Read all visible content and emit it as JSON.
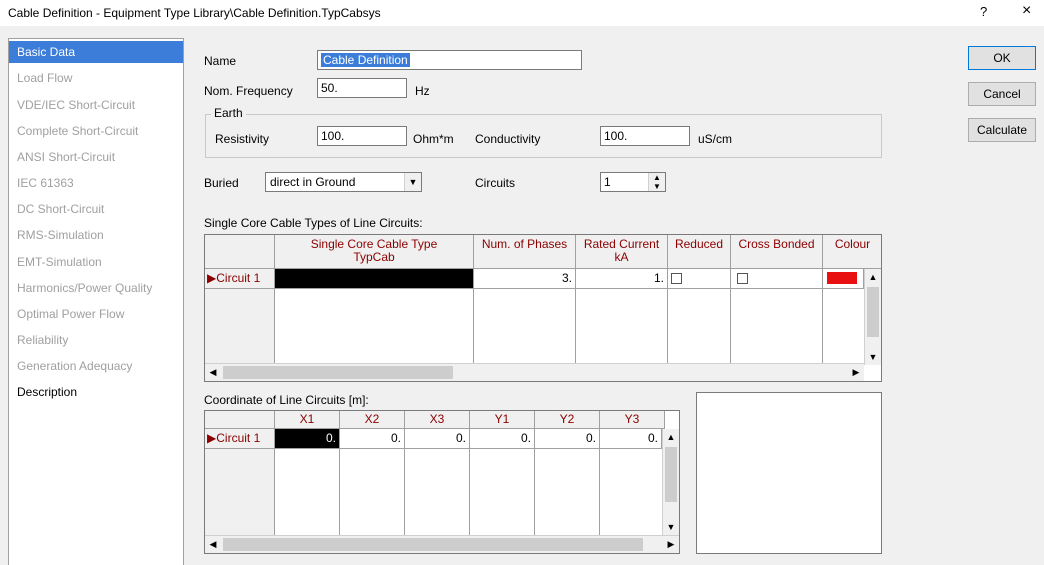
{
  "window": {
    "title": "Cable Definition - Equipment Type Library\\Cable Definition.TypCabsys",
    "help_label": "?",
    "close_label": "×"
  },
  "sidebar": {
    "items": [
      {
        "label": "Basic Data",
        "state": "selected"
      },
      {
        "label": "Load Flow",
        "state": "disabled"
      },
      {
        "label": "VDE/IEC Short-Circuit",
        "state": "disabled"
      },
      {
        "label": "Complete Short-Circuit",
        "state": "disabled"
      },
      {
        "label": "ANSI Short-Circuit",
        "state": "disabled"
      },
      {
        "label": "IEC 61363",
        "state": "disabled"
      },
      {
        "label": "DC Short-Circuit",
        "state": "disabled"
      },
      {
        "label": "RMS-Simulation",
        "state": "disabled"
      },
      {
        "label": "EMT-Simulation",
        "state": "disabled"
      },
      {
        "label": "Harmonics/Power Quality",
        "state": "disabled"
      },
      {
        "label": "Optimal Power Flow",
        "state": "disabled"
      },
      {
        "label": "Reliability",
        "state": "disabled"
      },
      {
        "label": "Generation Adequacy",
        "state": "disabled"
      },
      {
        "label": "Description",
        "state": "enabled"
      }
    ]
  },
  "buttons": {
    "ok": "OK",
    "cancel": "Cancel",
    "calculate": "Calculate"
  },
  "form": {
    "name_label": "Name",
    "name_value": "Cable Definition",
    "freq_label": "Nom. Frequency",
    "freq_value": "50.",
    "freq_unit": "Hz",
    "earth_label": "Earth",
    "resistivity_label": "Resistivity",
    "resistivity_value": "100.",
    "resistivity_unit": "Ohm*m",
    "conductivity_label": "Conductivity",
    "conductivity_value": "100.",
    "conductivity_unit": "uS/cm",
    "buried_label": "Buried",
    "buried_value": "direct in Ground",
    "circuits_label": "Circuits",
    "circuits_value": "1"
  },
  "single_core_table": {
    "title": "Single Core Cable Types of Line Circuits:",
    "headers": {
      "type": "Single Core Cable Type",
      "type_sub": "TypCab",
      "phases": "Num. of Phases",
      "rated": "Rated Current",
      "rated_sub": "kA",
      "reduced": "Reduced",
      "cross": "Cross Bonded",
      "colour": "Colour"
    },
    "row": {
      "label": "Circuit 1",
      "phases": "3.",
      "rated": "1."
    },
    "colour_swatch": "#e81010"
  },
  "coord_table": {
    "title": "Coordinate of Line Circuits [m]:",
    "headers": [
      "X1",
      "X2",
      "X3",
      "Y1",
      "Y2",
      "Y3"
    ],
    "row": {
      "label": "Circuit 1",
      "values": [
        "0.",
        "0.",
        "0.",
        "0.",
        "0.",
        "0."
      ]
    }
  }
}
